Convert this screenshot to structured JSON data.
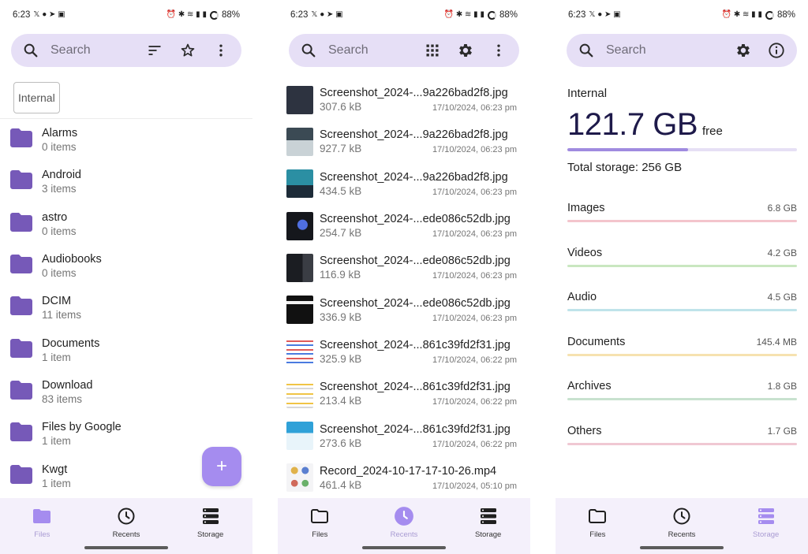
{
  "status": {
    "time": "6:23",
    "battery": "88%",
    "left_glyphs": "𝕏 ● ➤ ▣",
    "right_glyphs": "⏰ ✱ ≋ ▮ ▮"
  },
  "files": {
    "search_placeholder": "Search",
    "chip_label": "Internal",
    "folders": [
      {
        "name": "Alarms",
        "count": "0 items"
      },
      {
        "name": "Android",
        "count": "3 items"
      },
      {
        "name": "astro",
        "count": "0 items"
      },
      {
        "name": "Audiobooks",
        "count": "0 items"
      },
      {
        "name": "DCIM",
        "count": "11 items"
      },
      {
        "name": "Documents",
        "count": "1 item"
      },
      {
        "name": "Download",
        "count": "83 items"
      },
      {
        "name": "Files by Google",
        "count": "1 item"
      },
      {
        "name": "Kwgt",
        "count": "1 item"
      }
    ],
    "fab_symbol": "+"
  },
  "recents": {
    "search_placeholder": "Search",
    "items": [
      {
        "name": "Screenshot_2024-...9a226bad2f8.jpg",
        "size": "307.6 kB",
        "date": "17/10/2024, 06:23 pm"
      },
      {
        "name": "Screenshot_2024-...9a226bad2f8.jpg",
        "size": "927.7 kB",
        "date": "17/10/2024, 06:23 pm"
      },
      {
        "name": "Screenshot_2024-...9a226bad2f8.jpg",
        "size": "434.5 kB",
        "date": "17/10/2024, 06:23 pm"
      },
      {
        "name": "Screenshot_2024-...ede086c52db.jpg",
        "size": "254.7 kB",
        "date": "17/10/2024, 06:23 pm"
      },
      {
        "name": "Screenshot_2024-...ede086c52db.jpg",
        "size": "116.9 kB",
        "date": "17/10/2024, 06:23 pm"
      },
      {
        "name": "Screenshot_2024-...ede086c52db.jpg",
        "size": "336.9 kB",
        "date": "17/10/2024, 06:23 pm"
      },
      {
        "name": "Screenshot_2024-...861c39fd2f31.jpg",
        "size": "325.9 kB",
        "date": "17/10/2024, 06:22 pm"
      },
      {
        "name": "Screenshot_2024-...861c39fd2f31.jpg",
        "size": "213.4 kB",
        "date": "17/10/2024, 06:22 pm"
      },
      {
        "name": "Screenshot_2024-...861c39fd2f31.jpg",
        "size": "273.6 kB",
        "date": "17/10/2024, 06:22 pm"
      },
      {
        "name": "Record_2024-10-17-17-10-26.mp4",
        "size": "461.4 kB",
        "date": "17/10/2024, 05:10 pm"
      }
    ]
  },
  "storage": {
    "search_placeholder": "Search",
    "volume_label": "Internal",
    "free_value": "121.7 GB",
    "free_suffix": "free",
    "used_fraction": 0.525,
    "total_label": "Total storage: 256 GB",
    "categories": [
      {
        "name": "Images",
        "size": "6.8 GB",
        "color": "#f3c4cc"
      },
      {
        "name": "Videos",
        "size": "4.2 GB",
        "color": "#c9e7c0"
      },
      {
        "name": "Audio",
        "size": "4.5 GB",
        "color": "#bfe3ea"
      },
      {
        "name": "Documents",
        "size": "145.4 MB",
        "color": "#f6e2b0"
      },
      {
        "name": "Archives",
        "size": "1.8 GB",
        "color": "#c8e2cf"
      },
      {
        "name": "Others",
        "size": "1.7 GB",
        "color": "#f0c8d3"
      }
    ]
  },
  "nav": {
    "files_label": "Files",
    "recents_label": "Recents",
    "storage_label": "Storage"
  },
  "colors": {
    "accent": "#7d63c8",
    "search_bg": "#e6dff6",
    "nav_bg": "#f4f0fb",
    "folder": "#7659b8"
  }
}
